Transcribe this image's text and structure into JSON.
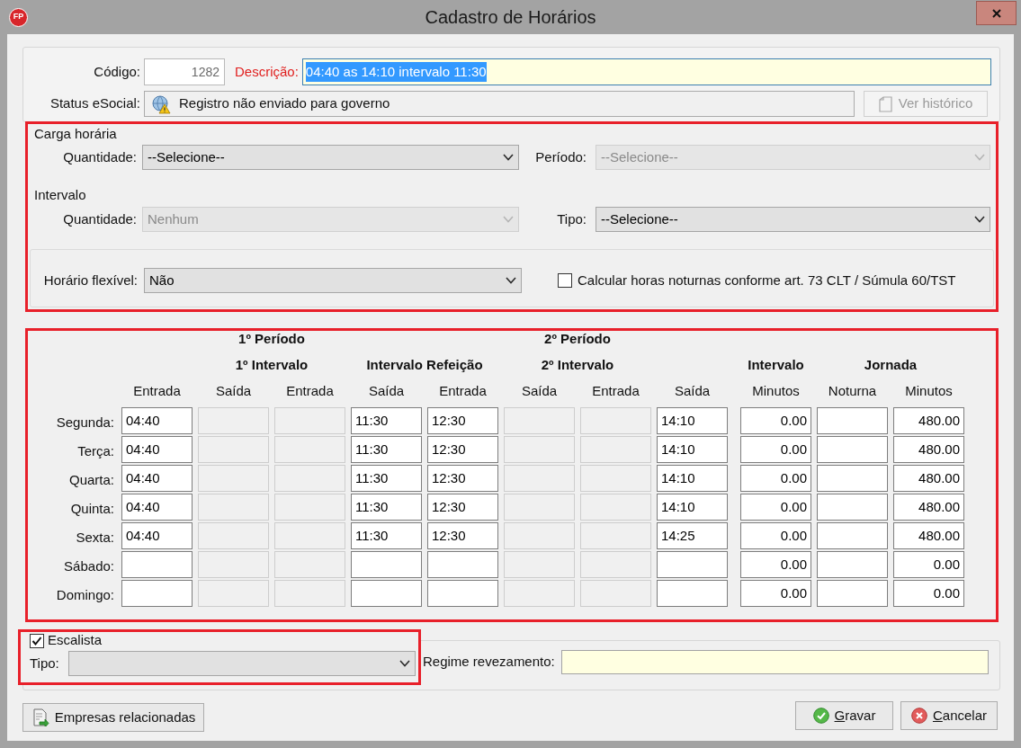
{
  "window": {
    "logo": "FP",
    "title": "Cadastro de Horários"
  },
  "header": {
    "codigo": {
      "label": "Código:",
      "value": "1282"
    },
    "descricao": {
      "label": "Descrição:",
      "value": "04:40 as 14:10 intervalo 11:30",
      "required": true,
      "selected": true
    },
    "status": {
      "label": "Status eSocial:",
      "value": "Registro não enviado para governo"
    },
    "history_button": {
      "label": "Ver histórico",
      "disabled": true
    }
  },
  "settings": {
    "highlighted": true,
    "carga_horaria": {
      "title": "Carga horária",
      "quantidade": {
        "label": "Quantidade:",
        "value": "--Selecione--",
        "disabled": false
      },
      "periodo": {
        "label": "Período:",
        "value": "--Selecione--",
        "disabled": true
      }
    },
    "intervalo": {
      "title": "Intervalo",
      "quantidade": {
        "label": "Quantidade:",
        "value": "Nenhum",
        "disabled": true
      },
      "tipo": {
        "label": "Tipo:",
        "value": "--Selecione--",
        "disabled": false
      }
    },
    "horario_flexivel": {
      "label": "Horário flexível:",
      "value": "Não",
      "disabled": false
    },
    "horas_noturnas": {
      "label": "Calcular horas noturnas conforme art. 73 CLT / Súmula 60/TST",
      "checked": false
    }
  },
  "schedule": {
    "highlighted": true,
    "period_headers": [
      "1º Período",
      "2º Período"
    ],
    "group_headers": [
      "1º Intervalo",
      "Intervalo Refeição",
      "2º Intervalo",
      "Intervalo",
      "Jornada"
    ],
    "columns": [
      {
        "label": "Entrada",
        "kind": "time"
      },
      {
        "label": "Saída",
        "kind": "time"
      },
      {
        "label": "Entrada",
        "kind": "time"
      },
      {
        "label": "Saída",
        "kind": "time"
      },
      {
        "label": "Entrada",
        "kind": "time"
      },
      {
        "label": "Saída",
        "kind": "time"
      },
      {
        "label": "Entrada",
        "kind": "time"
      },
      {
        "label": "Saída",
        "kind": "time"
      },
      {
        "label": "Minutos",
        "kind": "number"
      },
      {
        "label": "Noturna",
        "kind": "number"
      },
      {
        "label": "Minutos",
        "kind": "number"
      }
    ],
    "rows": [
      {
        "day": "Segunda:",
        "cells": [
          {
            "value": "04:40",
            "disabled": false
          },
          {
            "disabled": true
          },
          {
            "disabled": true
          },
          {
            "value": "11:30",
            "disabled": false
          },
          {
            "value": "12:30",
            "disabled": false
          },
          {
            "disabled": true
          },
          {
            "disabled": true
          },
          {
            "value": "14:10",
            "disabled": false
          },
          {
            "value": "0.00",
            "disabled": false
          },
          {
            "disabled": false
          },
          {
            "value": "480.00",
            "disabled": false
          }
        ]
      },
      {
        "day": "Terça:",
        "cells": [
          {
            "value": "04:40",
            "disabled": false
          },
          {
            "disabled": true
          },
          {
            "disabled": true
          },
          {
            "value": "11:30",
            "disabled": false
          },
          {
            "value": "12:30",
            "disabled": false
          },
          {
            "disabled": true
          },
          {
            "disabled": true
          },
          {
            "value": "14:10",
            "disabled": false
          },
          {
            "value": "0.00",
            "disabled": false
          },
          {
            "disabled": false
          },
          {
            "value": "480.00",
            "disabled": false
          }
        ]
      },
      {
        "day": "Quarta:",
        "cells": [
          {
            "value": "04:40",
            "disabled": false
          },
          {
            "disabled": true
          },
          {
            "disabled": true
          },
          {
            "value": "11:30",
            "disabled": false
          },
          {
            "value": "12:30",
            "disabled": false
          },
          {
            "disabled": true
          },
          {
            "disabled": true
          },
          {
            "value": "14:10",
            "disabled": false
          },
          {
            "value": "0.00",
            "disabled": false
          },
          {
            "disabled": false
          },
          {
            "value": "480.00",
            "disabled": false
          }
        ]
      },
      {
        "day": "Quinta:",
        "cells": [
          {
            "value": "04:40",
            "disabled": false
          },
          {
            "disabled": true
          },
          {
            "disabled": true
          },
          {
            "value": "11:30",
            "disabled": false
          },
          {
            "value": "12:30",
            "disabled": false
          },
          {
            "disabled": true
          },
          {
            "disabled": true
          },
          {
            "value": "14:10",
            "disabled": false
          },
          {
            "value": "0.00",
            "disabled": false
          },
          {
            "disabled": false
          },
          {
            "value": "480.00",
            "disabled": false
          }
        ]
      },
      {
        "day": "Sexta:",
        "cells": [
          {
            "value": "04:40",
            "disabled": false
          },
          {
            "disabled": true
          },
          {
            "disabled": true
          },
          {
            "value": "11:30",
            "disabled": false
          },
          {
            "value": "12:30",
            "disabled": false
          },
          {
            "disabled": true
          },
          {
            "disabled": true
          },
          {
            "value": "14:25",
            "disabled": false
          },
          {
            "value": "0.00",
            "disabled": false
          },
          {
            "disabled": false
          },
          {
            "value": "480.00",
            "disabled": false
          }
        ]
      },
      {
        "day": "Sábado:",
        "cells": [
          {
            "disabled": false
          },
          {
            "disabled": true
          },
          {
            "disabled": true
          },
          {
            "disabled": false
          },
          {
            "disabled": false
          },
          {
            "disabled": true
          },
          {
            "disabled": true
          },
          {
            "disabled": false
          },
          {
            "value": "0.00",
            "disabled": false
          },
          {
            "disabled": false
          },
          {
            "value": "0.00",
            "disabled": false
          }
        ]
      },
      {
        "day": "Domingo:",
        "cells": [
          {
            "disabled": false
          },
          {
            "disabled": true
          },
          {
            "disabled": true
          },
          {
            "disabled": false
          },
          {
            "disabled": false
          },
          {
            "disabled": true
          },
          {
            "disabled": true
          },
          {
            "disabled": false
          },
          {
            "value": "0.00",
            "disabled": false
          },
          {
            "disabled": false
          },
          {
            "value": "0.00",
            "disabled": false
          }
        ]
      }
    ]
  },
  "escala": {
    "highlighted": true,
    "escalista": {
      "label": "Escalista",
      "checked": true
    },
    "tipo": {
      "label": "Tipo:",
      "disabled": false
    },
    "regime_revezamento": {
      "label": "Regime revezamento:"
    }
  },
  "buttons": [
    {
      "label": "Empresas relacionadas",
      "kind": "related"
    },
    {
      "label": "Gravar",
      "kind": "save",
      "mnemonic": true
    },
    {
      "label": "Cancelar",
      "kind": "cancel",
      "mnemonic": true
    }
  ]
}
